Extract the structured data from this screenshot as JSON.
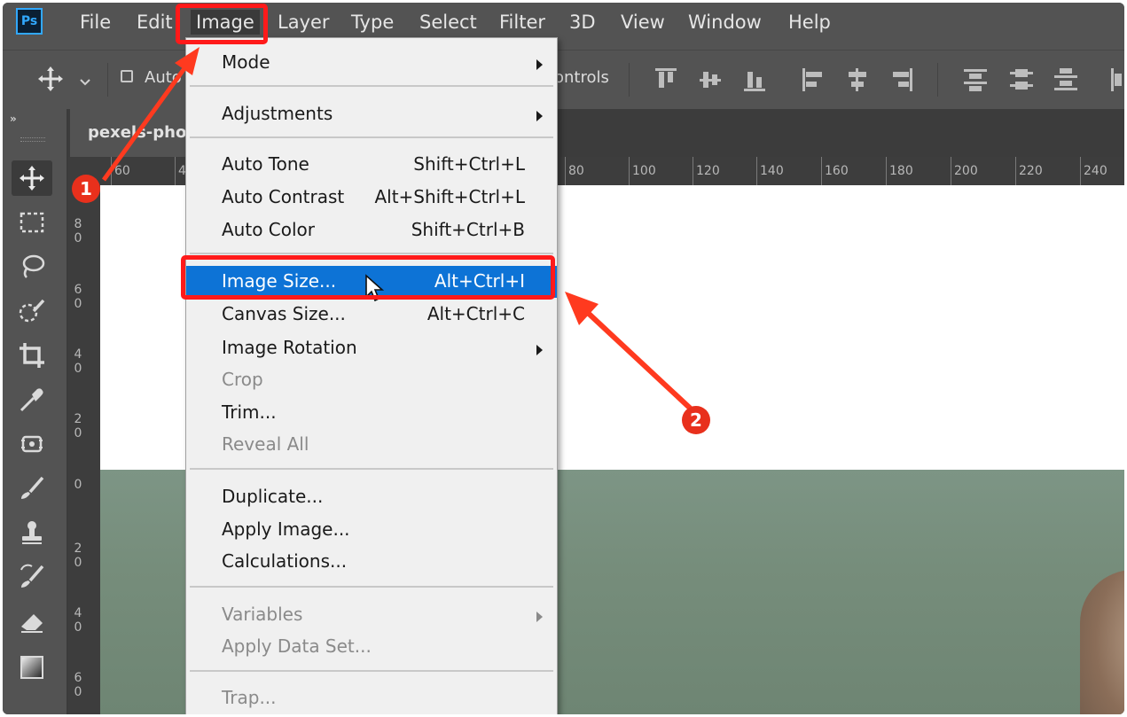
{
  "app": {
    "logo_text": "Ps",
    "brand_color": "#31a8ff"
  },
  "menubar": {
    "items": [
      "File",
      "Edit",
      "Image",
      "Layer",
      "Type",
      "Select",
      "Filter",
      "3D",
      "View",
      "Window",
      "Help"
    ],
    "active": "Image"
  },
  "options_bar": {
    "auto_select_label": "Auto",
    "transform_controls_label": "ontrols",
    "auto_select_checked": false
  },
  "document": {
    "tab_title": "pexels-pho"
  },
  "rulers": {
    "horizontal": [
      "60",
      "4",
      "80",
      "100",
      "120",
      "140",
      "160",
      "180",
      "200",
      "220",
      "240"
    ],
    "vertical": [
      [
        "8",
        "0"
      ],
      [
        "6",
        "0"
      ],
      [
        "4",
        "0"
      ],
      [
        "2",
        "0"
      ],
      [
        "0"
      ],
      [
        "2",
        "0"
      ],
      [
        "4",
        "0"
      ],
      [
        "6",
        "0"
      ]
    ]
  },
  "image_menu": {
    "items": [
      {
        "label": "Mode",
        "submenu": true
      },
      {
        "label": "Adjustments",
        "submenu": true
      },
      {
        "label": "Auto Tone",
        "shortcut": "Shift+Ctrl+L"
      },
      {
        "label": "Auto Contrast",
        "shortcut": "Alt+Shift+Ctrl+L"
      },
      {
        "label": "Auto Color",
        "shortcut": "Shift+Ctrl+B"
      },
      {
        "label": "Image Size...",
        "shortcut": "Alt+Ctrl+I",
        "highlighted": true
      },
      {
        "label": "Canvas Size...",
        "shortcut": "Alt+Ctrl+C"
      },
      {
        "label": "Image Rotation",
        "submenu": true
      },
      {
        "label": "Crop",
        "disabled": true
      },
      {
        "label": "Trim..."
      },
      {
        "label": "Reveal All",
        "disabled": true
      },
      {
        "label": "Duplicate..."
      },
      {
        "label": "Apply Image..."
      },
      {
        "label": "Calculations..."
      },
      {
        "label": "Variables",
        "submenu": true,
        "disabled": true
      },
      {
        "label": "Apply Data Set...",
        "disabled": true
      },
      {
        "label": "Trap...",
        "disabled": true
      }
    ]
  },
  "annotations": {
    "step1": "1",
    "step2": "2",
    "color": "#ff1a1a"
  },
  "tools": [
    "move-icon",
    "marquee-icon",
    "lasso-icon",
    "quick-select-icon",
    "crop-icon",
    "eyedropper-icon",
    "healing-icon",
    "brush-icon",
    "stamp-icon",
    "history-brush-icon",
    "eraser-icon",
    "gradient-icon"
  ]
}
